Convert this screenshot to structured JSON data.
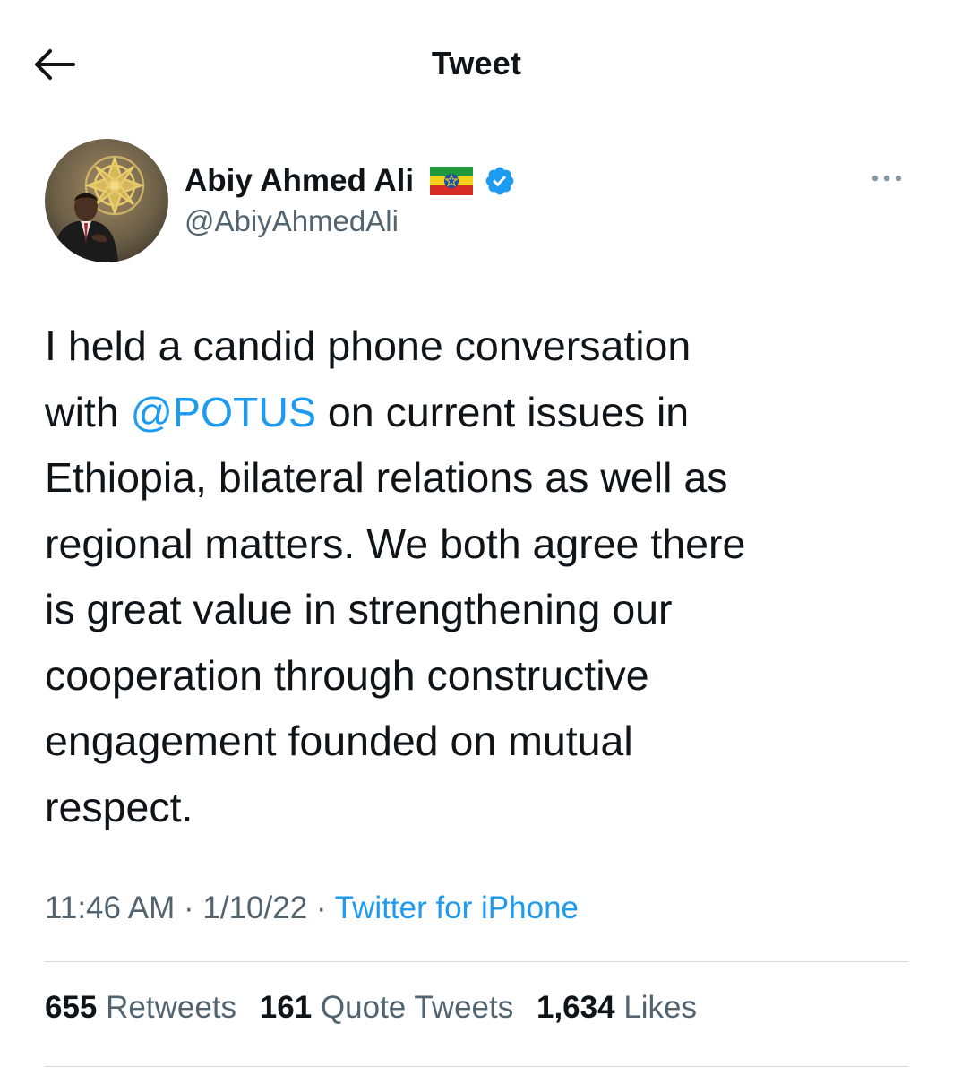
{
  "header": {
    "title": "Tweet",
    "back_icon": "arrow-left-icon"
  },
  "author": {
    "name": "Abiy Ahmed Ali",
    "handle": "@AbiyAhmedAli",
    "flag_icon": "ethiopia-flag-icon",
    "verified_icon": "verified-badge-icon",
    "verified_color": "#1d9bf0"
  },
  "more_icon": "more-dots-icon",
  "tweet": {
    "lines": [
      "I held a candid phone conversation",
      "",
      "Ethiopia, bilateral relations as well as",
      "regional matters. We both agree there",
      "is great value in strengthening our",
      "cooperation through constructive",
      "engagement founded on mutual",
      "respect."
    ],
    "line2_prefix": "with ",
    "mention": "@POTUS",
    "line2_suffix": " on current issues in"
  },
  "meta": {
    "time": "11:46 AM",
    "separator": " · ",
    "date": "1/10/22",
    "source": "Twitter for iPhone"
  },
  "stats": {
    "retweets_count": "655",
    "retweets_label": "Retweets",
    "quotes_count": "161",
    "quotes_label": "Quote Tweets",
    "likes_count": "1,634",
    "likes_label": "Likes"
  },
  "colors": {
    "accent": "#1d9bf0",
    "text": "#0f1419",
    "secondary": "#536471",
    "divider": "#cfd9de"
  }
}
